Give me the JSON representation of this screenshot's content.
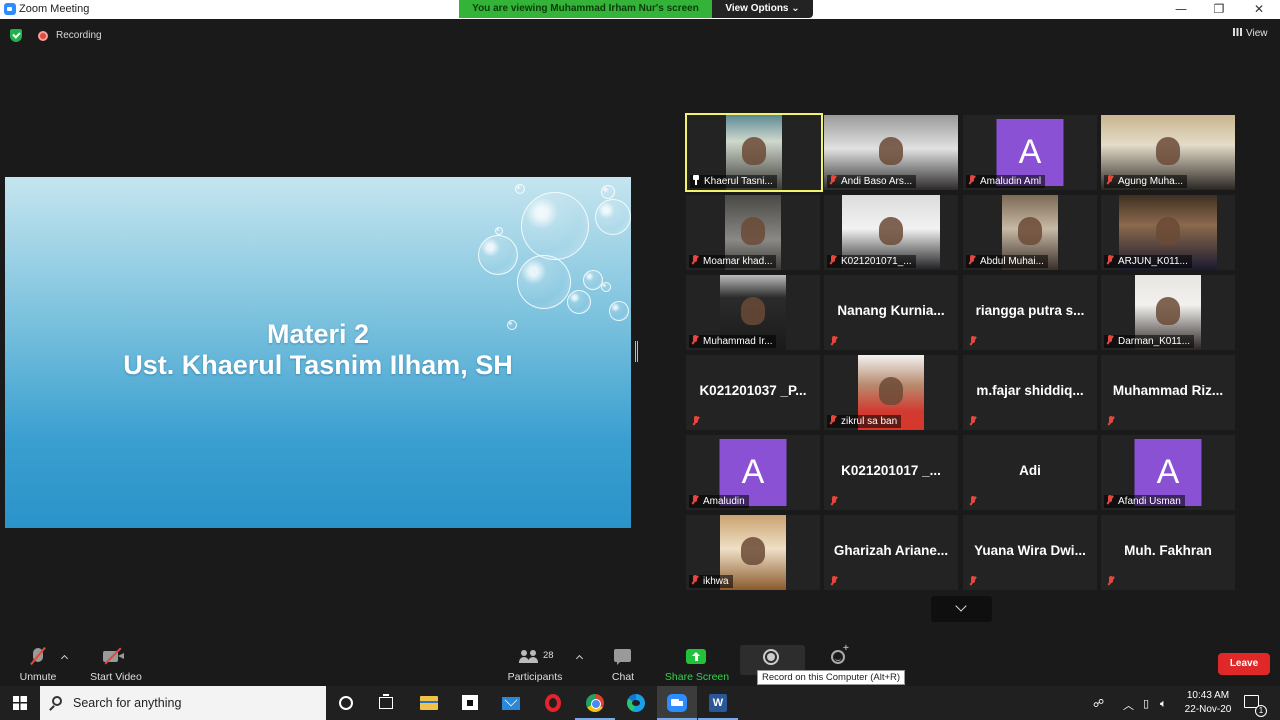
{
  "window": {
    "title": "Zoom Meeting",
    "minimize_glyph": "—",
    "maximize_glyph": "❐",
    "close_glyph": "✕"
  },
  "banner": {
    "viewing_text": "You are viewing Muhammad Irham Nur's screen",
    "view_options_label": "View Options ⌄"
  },
  "status": {
    "recording_label": "Recording",
    "view_label": "View"
  },
  "slide": {
    "line1": "Materi  2",
    "line2": "Ust. Khaerul Tasnim Ilham, SH"
  },
  "participants": [
    {
      "name": "Khaerul Tasni...",
      "kind": "photo",
      "active": true,
      "pinned": true
    },
    {
      "name": "Andi Baso Ars...",
      "kind": "photo"
    },
    {
      "name": "Amaludin Aml",
      "kind": "avatar",
      "avatar_letter": "A"
    },
    {
      "name": "Agung Muha...",
      "kind": "photo"
    },
    {
      "name": "Moamar khad...",
      "kind": "photo"
    },
    {
      "name": "K021201071_...",
      "kind": "photo"
    },
    {
      "name": "Abdul Muhai...",
      "kind": "photo"
    },
    {
      "name": "ARJUN_K011...",
      "kind": "photo"
    },
    {
      "name": "Muhammad Ir...",
      "kind": "photo"
    },
    {
      "name": "Nanang Kurnia...",
      "kind": "text"
    },
    {
      "name": "riangga putra s...",
      "kind": "text"
    },
    {
      "name": "Darman_K011...",
      "kind": "photo"
    },
    {
      "name": "K021201037 _P...",
      "kind": "text"
    },
    {
      "name": "zikrul sa ban",
      "kind": "photo"
    },
    {
      "name": "m.fajar shiddiq...",
      "kind": "text"
    },
    {
      "name": "Muhammad Riz...",
      "kind": "text"
    },
    {
      "name": "Amaludin",
      "kind": "avatar",
      "avatar_letter": "A"
    },
    {
      "name": "K021201017 _...",
      "kind": "text"
    },
    {
      "name": "Adi",
      "kind": "text"
    },
    {
      "name": "Afandi Usman",
      "kind": "avatar",
      "avatar_letter": "A"
    },
    {
      "name": "ikhwa",
      "kind": "photo"
    },
    {
      "name": "Gharizah Ariane...",
      "kind": "text"
    },
    {
      "name": "Yuana Wira Dwi...",
      "kind": "text"
    },
    {
      "name": "Muh. Fakhran",
      "kind": "text"
    }
  ],
  "toolbar": {
    "unmute_label": "Unmute",
    "start_video_label": "Start Video",
    "participants_label": "Participants",
    "participants_count": "28",
    "chat_label": "Chat",
    "share_label": "Share Screen",
    "record_tooltip": "Record on this Computer (Alt+R)",
    "leave_label": "Leave"
  },
  "taskbar": {
    "search_placeholder": "Search for anything",
    "time": "10:43 AM",
    "date": "22-Nov-20",
    "notification_count": "1",
    "word_glyph": "W"
  },
  "colors": {
    "accent_green": "#33b337",
    "leave_red": "#e02828",
    "active_border": "#f2f26b",
    "avatar_purple": "#8a51d4"
  }
}
